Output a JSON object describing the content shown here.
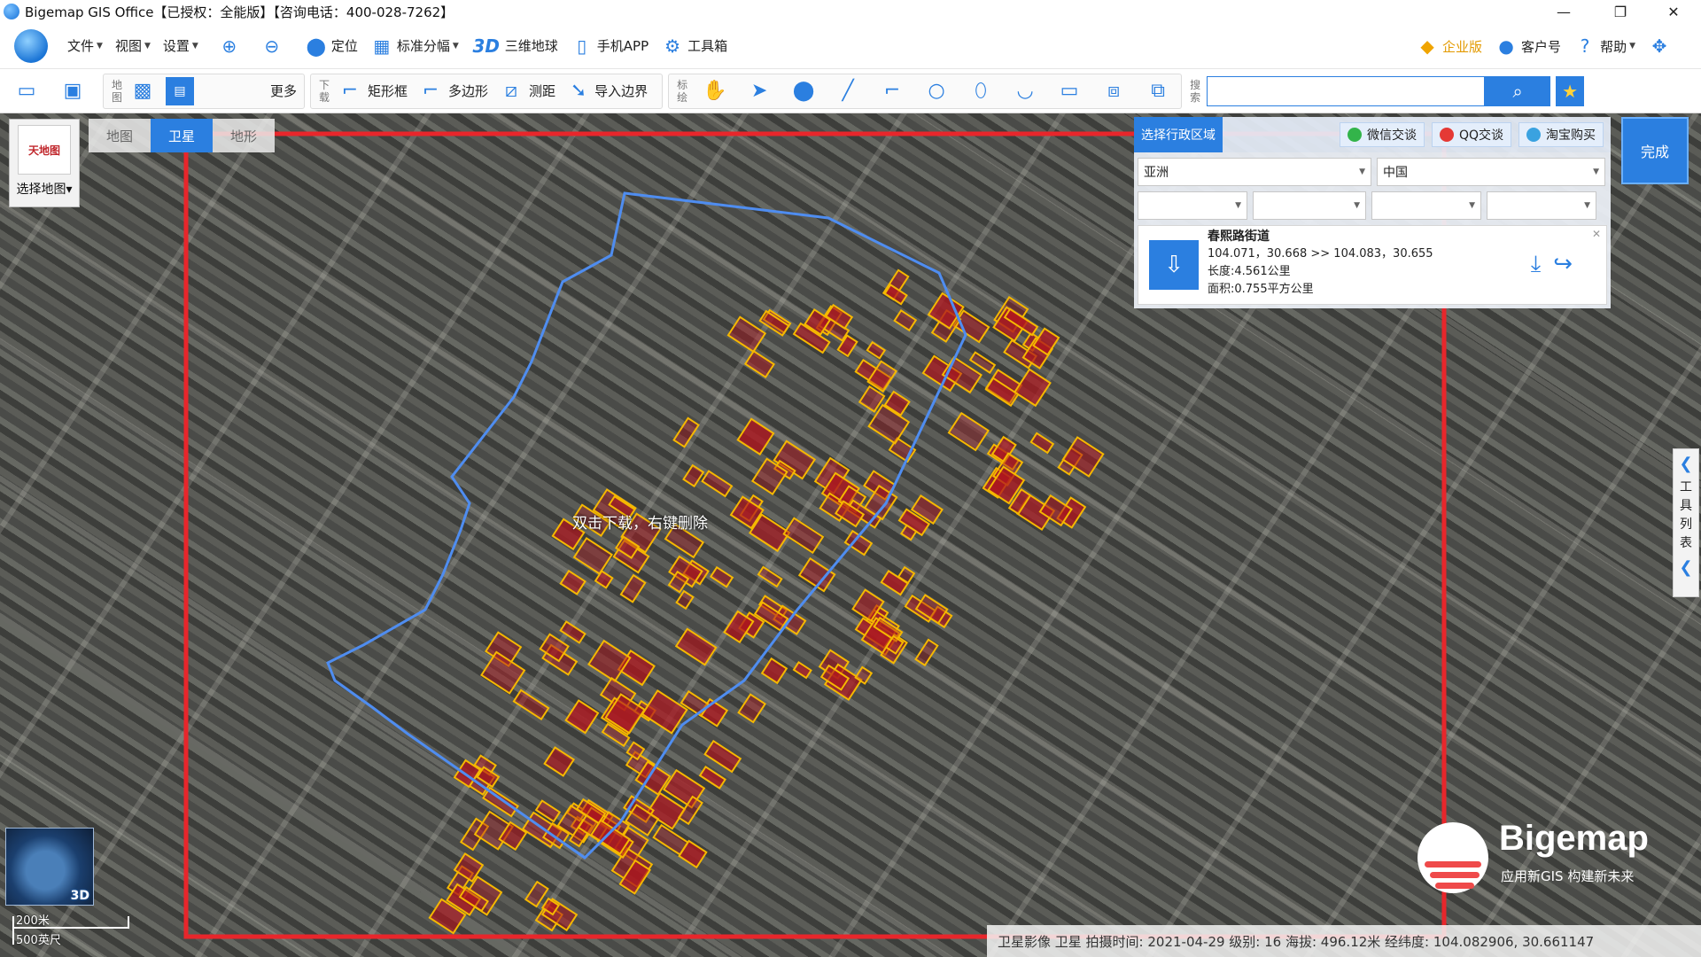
{
  "window": {
    "title": "Bigemap GIS Office【已授权：全能版】【咨询电话：400-028-7262】",
    "controls": [
      "—",
      "❐",
      "✕"
    ]
  },
  "menubar": {
    "items": [
      {
        "label": "文件",
        "caret": true
      },
      {
        "label": "视图",
        "caret": true
      },
      {
        "label": "设置",
        "caret": true
      }
    ],
    "zoom_in_icon": "zoom-in-icon",
    "zoom_out_icon": "zoom-out-icon",
    "locate": "定位",
    "standard_grid": "标准分幅",
    "threed_label": "3D",
    "threed_globe": "三维地球",
    "mobile_app": "手机APP",
    "toolbox": "工具箱",
    "enterprise": "企业版",
    "customer": "客户号",
    "help": "帮助"
  },
  "toolbar2": {
    "map_group_label": "地图",
    "more": "更多",
    "download_group_label": "下载",
    "rect": "矩形框",
    "polygon": "多边形",
    "measure": "测距",
    "import_boundary": "导入边界",
    "mark_group_label": "标绘",
    "search_group_label": "搜索",
    "search_placeholder": ""
  },
  "map": {
    "selector_label": "选择地图",
    "selector_thumb": "天地图",
    "tabs": [
      {
        "label": "地图",
        "active": false
      },
      {
        "label": "卫星",
        "active": true
      },
      {
        "label": "地形",
        "active": false
      }
    ],
    "hint": "双击下载，右键删除"
  },
  "region_panel": {
    "title": "选择行政区域",
    "wechat": "微信交谈",
    "qq": "QQ交谈",
    "taobao": "淘宝购买",
    "continent": "亚洲",
    "country": "中国",
    "level3": "",
    "level4": "",
    "level5": "",
    "level6": "",
    "result": {
      "name": "春熙路街道",
      "coords": "104.071，30.668 >> 104.083，30.655",
      "length": "长度:4.561公里",
      "area": "面积:0.755平方公里"
    }
  },
  "done_button": "完成",
  "tool_tab": "工具列表",
  "brand": {
    "name": "Bigemap",
    "slogan": "应用新GIS  构建新未来"
  },
  "mini_globe_label": "3D",
  "scale": {
    "metric": "200米",
    "imperial": "500英尺"
  },
  "statusbar": {
    "text": "卫星影像 卫星   拍摄时间: 2021-04-29   级别: 16   海拔: 496.12米     经纬度:  104.082906, 30.661147"
  },
  "colors": {
    "accent": "#2b7fe0",
    "selection_frame": "#e8262b",
    "boundary": "#4f8df0",
    "building_outline": "#f5b800",
    "building_fill": "#b0161e"
  }
}
